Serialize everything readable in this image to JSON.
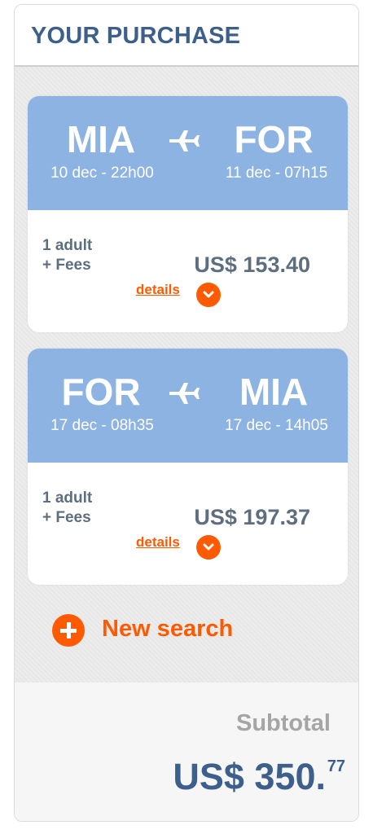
{
  "header": {
    "title": "YOUR PURCHASE"
  },
  "flights": [
    {
      "from_code": "MIA",
      "to_code": "FOR",
      "depart": "10 dec - 22h00",
      "arrive": "11 dec - 07h15",
      "passengers": "1 adult",
      "fees": "+ Fees",
      "price": "US$ 153.40",
      "details_label": "details"
    },
    {
      "from_code": "FOR",
      "to_code": "MIA",
      "depart": "17 dec - 08h35",
      "arrive": "17 dec - 14h05",
      "passengers": "1 adult",
      "fees": "+ Fees",
      "price": "US$ 197.37",
      "details_label": "details"
    }
  ],
  "new_search": {
    "label": "New search",
    "icon": "plus-circle-icon"
  },
  "subtotal": {
    "label": "Subtotal",
    "amount": "US$ 350.",
    "cents": "77"
  },
  "colors": {
    "title": "#3d5f8c",
    "route_bar": "#8db3e2",
    "accent": "#ff5a00",
    "price_text": "#5d6e7f"
  },
  "icons": {
    "plane": "airplane-icon",
    "details_toggle": "chevron-down-icon"
  }
}
